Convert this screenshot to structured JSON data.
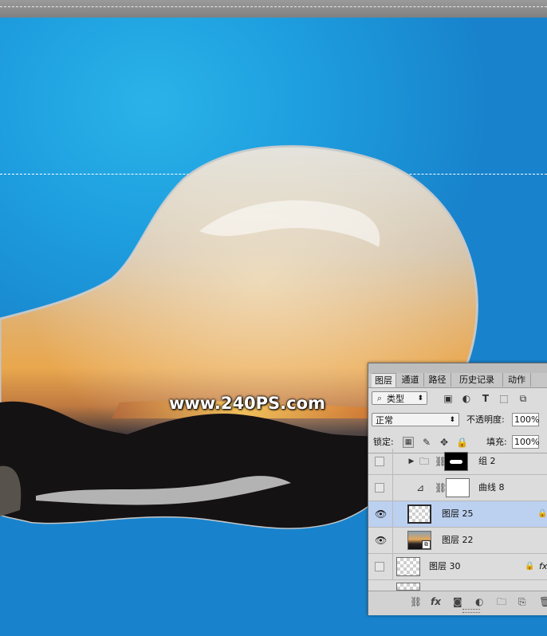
{
  "watermark": "www.240PS.com",
  "panel": {
    "tabs": [
      "图层",
      "通道",
      "路径",
      "历史记录",
      "动作"
    ],
    "filter": {
      "label": "类型",
      "search_icon": "search-icon"
    },
    "blend_mode": "正常",
    "opacity_label": "不透明度:",
    "opacity_value": "100%",
    "lock_label": "锁定:",
    "fill_label": "填充:",
    "fill_value": "100%",
    "layers": [
      {
        "name": "组 2",
        "type": "group",
        "visible": false
      },
      {
        "name": "曲线 8",
        "type": "adjustment-curves",
        "visible": false
      },
      {
        "name": "图层 25",
        "type": "pixel",
        "visible": true,
        "selected": true
      },
      {
        "name": "图层 22",
        "type": "smart-object",
        "visible": true
      },
      {
        "name": "图层 30",
        "type": "pixel",
        "visible": false,
        "fx": "fx"
      }
    ],
    "bottom_icons": [
      "link-icon",
      "fx-icon",
      "mask-icon",
      "adjustment-icon",
      "folder-icon",
      "new-layer-icon",
      "trash-icon"
    ],
    "fx_label": "fx"
  }
}
